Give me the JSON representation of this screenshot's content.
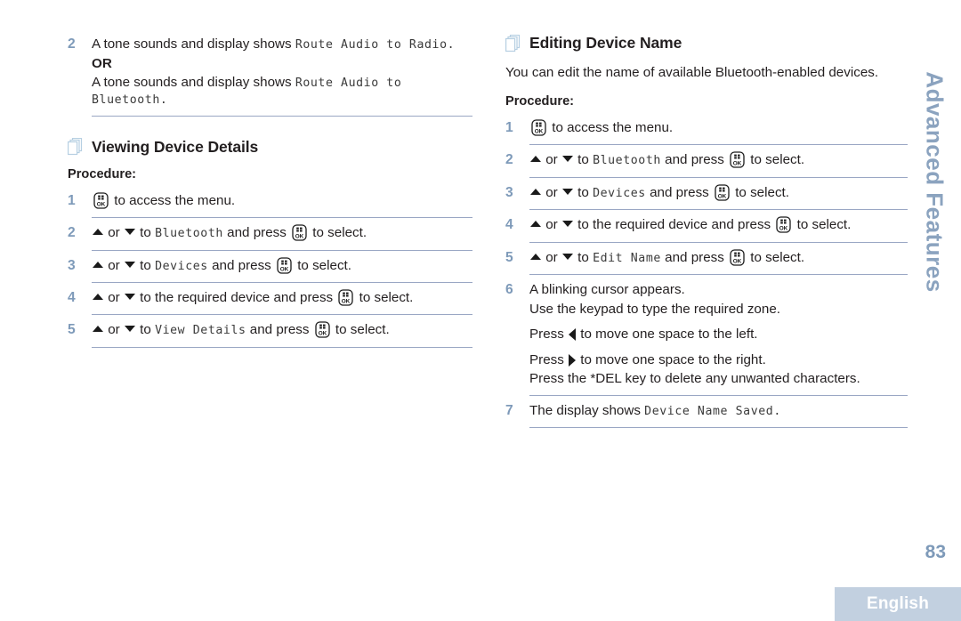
{
  "document": {
    "page_number": "83",
    "side_tab_label": "Advanced Features",
    "footer_language": "English",
    "accent_color": "#7e9ab9",
    "rule_color": "#9aa7c4",
    "footer_bar_color": "#c2d0e0"
  },
  "left_column": {
    "continued_step": {
      "number": "2",
      "line1_prefix": "A tone sounds and display shows ",
      "line1_lcd": "Route Audio to Radio.",
      "or_label": "OR",
      "line2_prefix": "A tone sounds and display shows ",
      "line2_lcd": "Route Audio to",
      "line3_lcd": "Bluetooth."
    },
    "section": {
      "icon": "pages-icon",
      "title": "Viewing Device Details",
      "procedure_label": "Procedure:",
      "steps": [
        {
          "number": "1",
          "parts": [
            {
              "type": "ok-key",
              "name": "ok-button-icon"
            },
            {
              "type": "text",
              "text": " to access the menu."
            }
          ]
        },
        {
          "number": "2",
          "parts": [
            {
              "type": "tri-up",
              "name": "arrow-up-icon"
            },
            {
              "type": "text",
              "text": " or "
            },
            {
              "type": "tri-down",
              "name": "arrow-down-icon"
            },
            {
              "type": "text",
              "text": " to "
            },
            {
              "type": "lcd",
              "text": "Bluetooth"
            },
            {
              "type": "text",
              "text": " and press "
            },
            {
              "type": "ok-key",
              "name": "ok-button-icon"
            },
            {
              "type": "text",
              "text": " to select."
            }
          ]
        },
        {
          "number": "3",
          "parts": [
            {
              "type": "tri-up",
              "name": "arrow-up-icon"
            },
            {
              "type": "text",
              "text": " or "
            },
            {
              "type": "tri-down",
              "name": "arrow-down-icon"
            },
            {
              "type": "text",
              "text": " to "
            },
            {
              "type": "lcd",
              "text": "Devices"
            },
            {
              "type": "text",
              "text": " and press "
            },
            {
              "type": "ok-key",
              "name": "ok-button-icon"
            },
            {
              "type": "text",
              "text": " to select."
            }
          ]
        },
        {
          "number": "4",
          "parts": [
            {
              "type": "tri-up",
              "name": "arrow-up-icon"
            },
            {
              "type": "text",
              "text": " or "
            },
            {
              "type": "tri-down",
              "name": "arrow-down-icon"
            },
            {
              "type": "text",
              "text": " to the required device and press "
            },
            {
              "type": "ok-key",
              "name": "ok-button-icon"
            },
            {
              "type": "text",
              "text": " to select."
            }
          ]
        },
        {
          "number": "5",
          "parts": [
            {
              "type": "tri-up",
              "name": "arrow-up-icon"
            },
            {
              "type": "text",
              "text": " or "
            },
            {
              "type": "tri-down",
              "name": "arrow-down-icon"
            },
            {
              "type": "text",
              "text": " to "
            },
            {
              "type": "lcd",
              "text": "View Details"
            },
            {
              "type": "text",
              "text": " and press "
            },
            {
              "type": "ok-key",
              "name": "ok-button-icon"
            },
            {
              "type": "text",
              "text": " to select."
            }
          ]
        }
      ]
    }
  },
  "right_column": {
    "section": {
      "icon": "pages-icon",
      "title": "Editing Device Name",
      "intro": "You can edit the name of available Bluetooth-enabled devices.",
      "procedure_label": "Procedure:",
      "steps": [
        {
          "number": "1",
          "parts": [
            {
              "type": "ok-key",
              "name": "ok-button-icon"
            },
            {
              "type": "text",
              "text": " to access the menu."
            }
          ]
        },
        {
          "number": "2",
          "parts": [
            {
              "type": "tri-up",
              "name": "arrow-up-icon"
            },
            {
              "type": "text",
              "text": " or "
            },
            {
              "type": "tri-down",
              "name": "arrow-down-icon"
            },
            {
              "type": "text",
              "text": " to "
            },
            {
              "type": "lcd",
              "text": "Bluetooth"
            },
            {
              "type": "text",
              "text": " and press "
            },
            {
              "type": "ok-key",
              "name": "ok-button-icon"
            },
            {
              "type": "text",
              "text": " to select."
            }
          ]
        },
        {
          "number": "3",
          "parts": [
            {
              "type": "tri-up",
              "name": "arrow-up-icon"
            },
            {
              "type": "text",
              "text": " or "
            },
            {
              "type": "tri-down",
              "name": "arrow-down-icon"
            },
            {
              "type": "text",
              "text": " to "
            },
            {
              "type": "lcd",
              "text": "Devices"
            },
            {
              "type": "text",
              "text": " and press "
            },
            {
              "type": "ok-key",
              "name": "ok-button-icon"
            },
            {
              "type": "text",
              "text": " to select."
            }
          ]
        },
        {
          "number": "4",
          "parts": [
            {
              "type": "tri-up",
              "name": "arrow-up-icon"
            },
            {
              "type": "text",
              "text": " or "
            },
            {
              "type": "tri-down",
              "name": "arrow-down-icon"
            },
            {
              "type": "text",
              "text": " to the required device and press "
            },
            {
              "type": "ok-key",
              "name": "ok-button-icon"
            },
            {
              "type": "text",
              "text": " to select."
            }
          ]
        },
        {
          "number": "5",
          "parts": [
            {
              "type": "tri-up",
              "name": "arrow-up-icon"
            },
            {
              "type": "text",
              "text": " or "
            },
            {
              "type": "tri-down",
              "name": "arrow-down-icon"
            },
            {
              "type": "text",
              "text": " to "
            },
            {
              "type": "lcd",
              "text": "Edit Name"
            },
            {
              "type": "text",
              "text": " and press "
            },
            {
              "type": "ok-key",
              "name": "ok-button-icon"
            },
            {
              "type": "text",
              "text": " to select."
            }
          ]
        },
        {
          "number": "6",
          "lines": [
            {
              "parts": [
                {
                  "type": "text",
                  "text": "A blinking cursor appears."
                }
              ]
            },
            {
              "parts": [
                {
                  "type": "text",
                  "text": "Use the keypad to type the required zone."
                }
              ]
            },
            {
              "gap": true,
              "parts": [
                {
                  "type": "text",
                  "text": "Press "
                },
                {
                  "type": "tri-left",
                  "name": "arrow-left-icon"
                },
                {
                  "type": "text",
                  "text": " to move one space to the left."
                }
              ]
            },
            {
              "gap": true,
              "parts": [
                {
                  "type": "text",
                  "text": "Press "
                },
                {
                  "type": "tri-right",
                  "name": "arrow-right-icon"
                },
                {
                  "type": "text",
                  "text": " to move one space to the right."
                }
              ]
            },
            {
              "parts": [
                {
                  "type": "text",
                  "text": "Press the *DEL key to delete any unwanted characters."
                }
              ]
            }
          ]
        },
        {
          "number": "7",
          "parts": [
            {
              "type": "text",
              "text": "The display shows "
            },
            {
              "type": "lcd",
              "text": "Device Name Saved."
            }
          ]
        }
      ]
    }
  }
}
